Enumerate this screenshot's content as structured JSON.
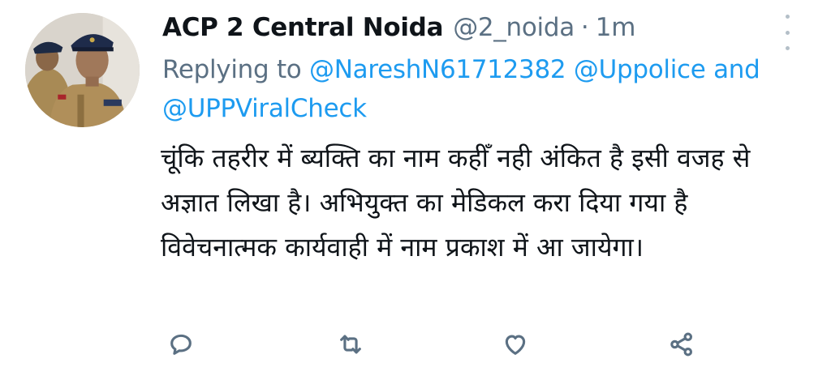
{
  "tweet": {
    "author_name": "ACP 2 Central Noida",
    "author_handle": "@2_noida",
    "separator": "·",
    "timestamp": "1m",
    "replying_prefix": "Replying to",
    "mentions": [
      "@NareshN61712382",
      "@Uppolice"
    ],
    "replying_and": "and",
    "mention_last": "@UPPViralCheck",
    "text": "चूंकि तहरीर में ब्यक्ति का नाम कहीँ नही अंकित है इसी वजह से अज्ञात लिखा है। अभियुक्त का मेडिकल करा दिया गया है विवेचनात्मक कार्यवाही में नाम प्रकाश में आ जायेगा।"
  },
  "icons": {
    "more": "more-vertical-icon",
    "reply": "reply-icon",
    "retweet": "retweet-icon",
    "like": "heart-icon",
    "share": "share-icon"
  },
  "colors": {
    "name": "#0f1419",
    "secondary": "#5b7083",
    "mention": "#1d9bf0",
    "background": "#ffffff"
  }
}
